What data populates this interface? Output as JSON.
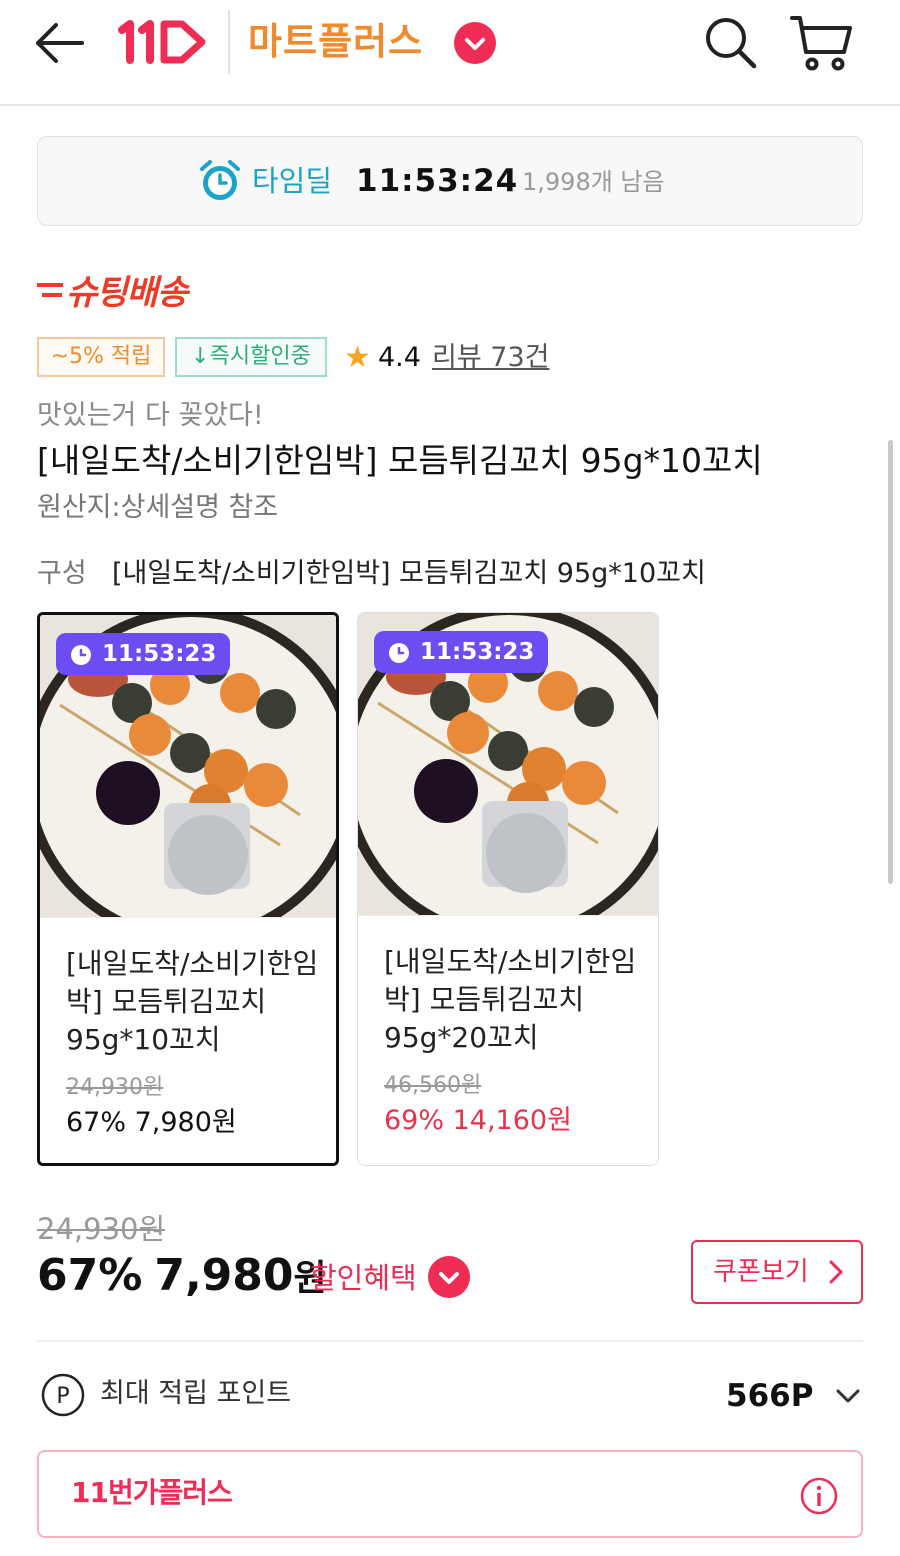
{
  "header": {
    "logo_text": "11",
    "store_name": "마트플러스"
  },
  "timedeal": {
    "label": "타임딜",
    "time": "11:53:24",
    "remaining": "1,998개 남음"
  },
  "delivery_badge": "슈팅배송",
  "badges": {
    "point_rate": "~5% 적립",
    "instant_discount": "↓즉시할인중"
  },
  "rating": {
    "star": "★",
    "value": "4.4",
    "review_link": "리뷰 73건"
  },
  "product": {
    "subtitle": "맛있는거 다 꽂았다!",
    "title": "[내일도착/소비기한임박] 모듬튀김꼬치 95g*10꼬치",
    "origin": "원산지:상세설명 참조",
    "composition_label": "구성",
    "composition_value": "[내일도착/소비기한임박] 모듬튀김꼬치 95g*10꼬치"
  },
  "options": [
    {
      "timer": "11:53:23",
      "title": "[내일도착/소비기한임박] 모듬튀김꼬치 95g*10꼬치",
      "original_price": "24,930원",
      "sale_price": "67% 7,980원",
      "selected": true,
      "price_color": "#111111"
    },
    {
      "timer": "11:53:23",
      "title": "[내일도착/소비기한임박] 모듬튀김꼬치 95g*20꼬치",
      "original_price": "46,560원",
      "sale_price": "69% 14,160원",
      "selected": false,
      "price_color": "#e8334a"
    }
  ],
  "price": {
    "original": "24,930원",
    "discount_rate": "67%",
    "final": "7,980",
    "currency": "원",
    "benefit_link": "할인혜택",
    "coupon_button": "쿠폰보기"
  },
  "points": {
    "icon_letter": "P",
    "label": "최대 적립 포인트",
    "value": "566P"
  },
  "membership": {
    "label": "11번가플러스"
  },
  "colors": {
    "brand_red": "#ef2d54",
    "store_orange": "#f08a2c",
    "timedeal_blue": "#1ba3c8",
    "timer_purple": "#6d4cf2"
  },
  "icons": {
    "back": "arrow-left-icon",
    "search": "search-icon",
    "cart": "cart-icon",
    "alarm": "alarm-clock-icon",
    "info": "info-icon",
    "points": "point-coin-icon"
  }
}
